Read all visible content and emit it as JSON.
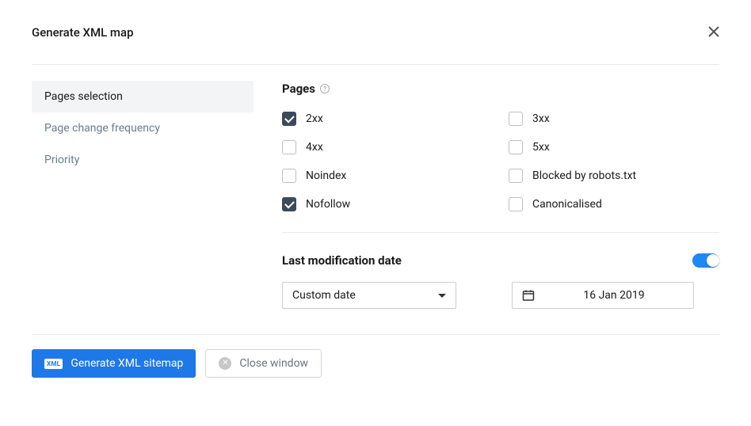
{
  "header": {
    "title": "Generate XML map"
  },
  "sidebar": {
    "items": [
      {
        "label": "Pages selection",
        "active": true
      },
      {
        "label": "Page change frequency",
        "active": false
      },
      {
        "label": "Priority",
        "active": false
      }
    ]
  },
  "pages": {
    "title": "Pages",
    "options": [
      {
        "label": "2xx",
        "checked": true
      },
      {
        "label": "3xx",
        "checked": false
      },
      {
        "label": "4xx",
        "checked": false
      },
      {
        "label": "5xx",
        "checked": false
      },
      {
        "label": "Noindex",
        "checked": false
      },
      {
        "label": "Blocked by robots.txt",
        "checked": false
      },
      {
        "label": "Nofollow",
        "checked": true
      },
      {
        "label": "Canonicalised",
        "checked": false
      }
    ]
  },
  "dateSection": {
    "title": "Last modification date",
    "toggle": true,
    "select": "Custom date",
    "date": "16 Jan 2019"
  },
  "footer": {
    "generate": "Generate XML sitemap",
    "close": "Close window"
  }
}
